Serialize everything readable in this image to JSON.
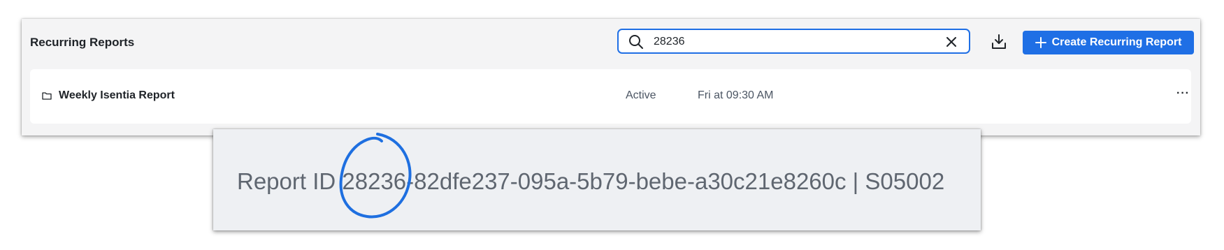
{
  "header": {
    "title": "Recurring Reports",
    "search": {
      "value": "28236",
      "icon": "search-icon",
      "clear_icon": "close-icon"
    },
    "download_icon": "download-icon",
    "create_button": {
      "label": "Create Recurring Report",
      "icon": "plus-icon"
    }
  },
  "rows": [
    {
      "icon": "folder-icon",
      "name": "Weekly Isentia Report",
      "status": "Active",
      "schedule": "Fri at 09:30 AM",
      "more": "···"
    }
  ],
  "zoom_callout": {
    "text": "Report ID 28236-82dfe237-095a-5b79-bebe-a30c21e8260c | S05002"
  },
  "colors": {
    "accent": "#1f6fe5",
    "panel_bg": "#f4f4f5",
    "callout_bg": "#eef0f3"
  }
}
